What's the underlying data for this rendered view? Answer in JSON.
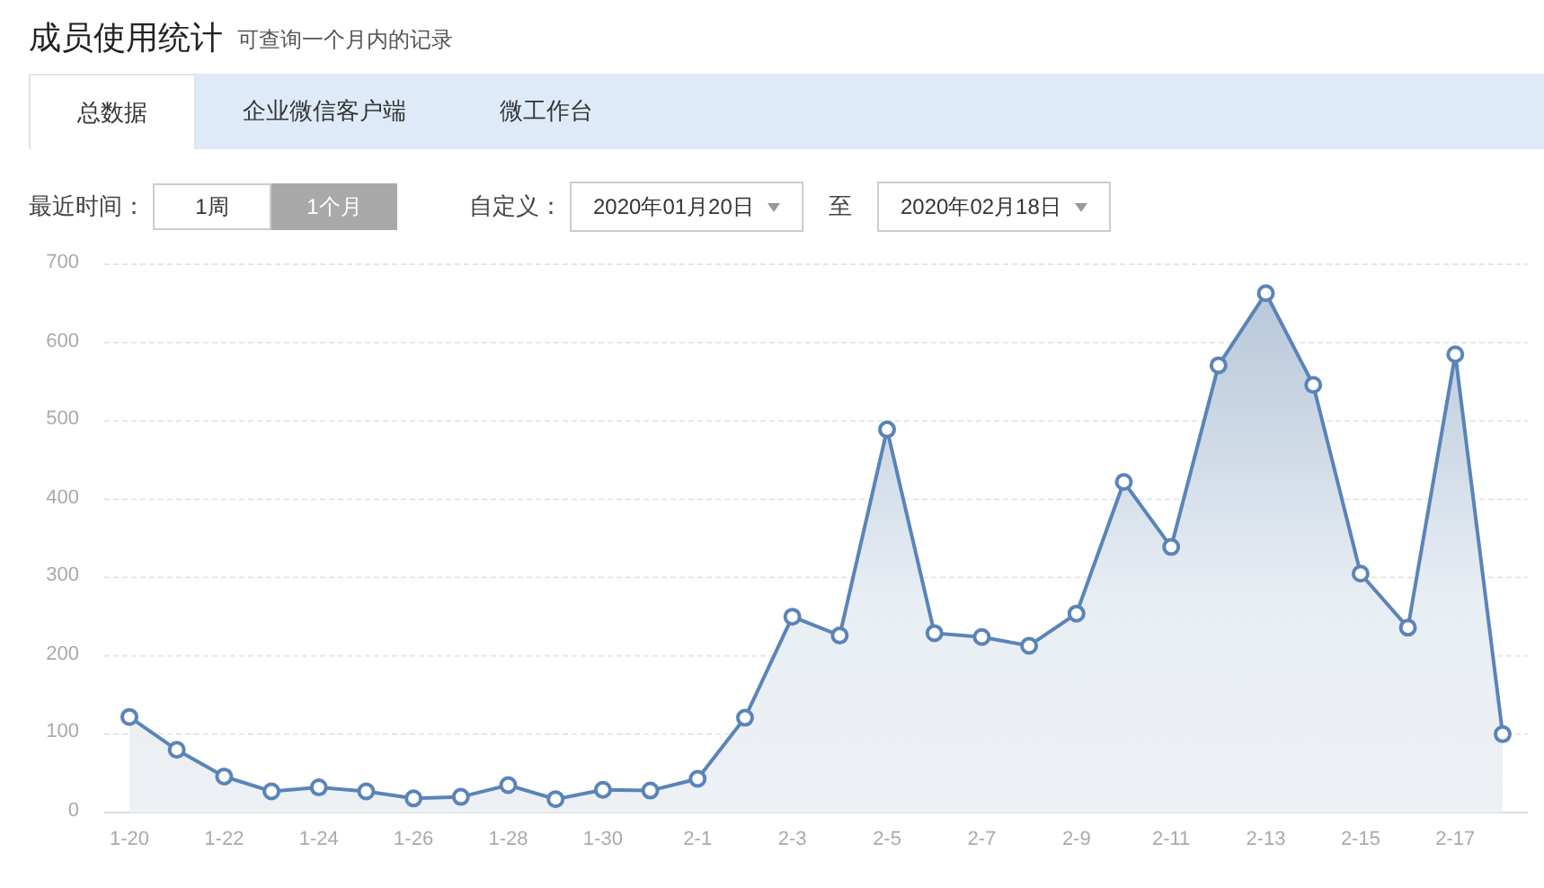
{
  "header": {
    "title": "成员使用统计",
    "subtitle": "可查询一个月内的记录"
  },
  "tabs": [
    {
      "label": "总数据",
      "selected": true
    },
    {
      "label": "企业微信客户端",
      "selected": false
    },
    {
      "label": "微工作台",
      "selected": false
    }
  ],
  "filters": {
    "recent_label": "最近时间：",
    "ranges": [
      {
        "label": "1周",
        "selected": false
      },
      {
        "label": "1个月",
        "selected": true
      }
    ],
    "custom_label": "自定义：",
    "start_date": "2020年01月20日",
    "separator": "至",
    "end_date": "2020年02月18日"
  },
  "chart": {
    "chart_data": {
      "type": "area",
      "categories": [
        "1-20",
        null,
        "1-22",
        null,
        "1-24",
        null,
        "1-26",
        null,
        "1-28",
        null,
        "1-30",
        null,
        "2-1",
        null,
        "2-3",
        null,
        "2-5",
        null,
        "2-7",
        null,
        "2-9",
        null,
        "2-11",
        null,
        "2-13",
        null,
        "2-15",
        null,
        "2-17",
        null
      ],
      "grid": true,
      "series": [
        {
          "color": "#5a84b8",
          "values": [
            122,
            80,
            46,
            27,
            32,
            27,
            18,
            20,
            35,
            17,
            29,
            28,
            43,
            121,
            250,
            226,
            489,
            229,
            224,
            213,
            254,
            422,
            339,
            571,
            663,
            546,
            305,
            236,
            585,
            100
          ]
        }
      ],
      "ylim": [
        0,
        700
      ],
      "yticks": [
        0,
        100,
        200,
        300,
        400,
        500,
        600,
        700
      ]
    }
  }
}
